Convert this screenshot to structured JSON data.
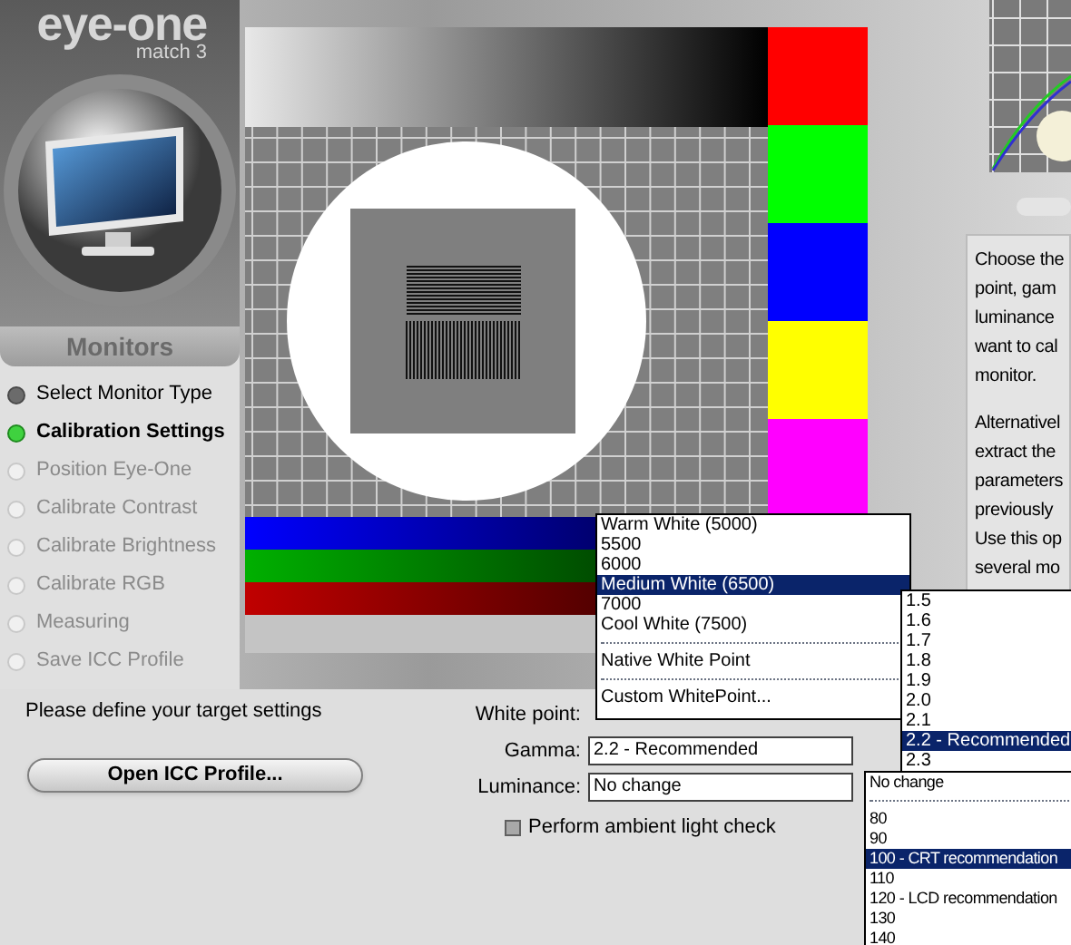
{
  "logo": {
    "name": "eye-one",
    "edition": "match 3"
  },
  "sidebar": {
    "title": "Monitors",
    "steps": [
      {
        "label": "Select Monitor Type",
        "done": true,
        "selected": false
      },
      {
        "label": "Calibration Settings",
        "done": false,
        "selected": true
      },
      {
        "label": "Position Eye-One",
        "done": false,
        "selected": false
      },
      {
        "label": "Calibrate Contrast",
        "done": false,
        "selected": false
      },
      {
        "label": "Calibrate Brightness",
        "done": false,
        "selected": false
      },
      {
        "label": "Calibrate RGB",
        "done": false,
        "selected": false
      },
      {
        "label": "Measuring",
        "done": false,
        "selected": false
      },
      {
        "label": "Save ICC Profile",
        "done": false,
        "selected": false
      }
    ]
  },
  "test_image": {
    "swatches": [
      {
        "color": "#ff0000"
      },
      {
        "color": "#00ff00"
      },
      {
        "color": "#0000ff"
      },
      {
        "color": "#ffff00"
      },
      {
        "color": "#ff00ff"
      }
    ],
    "ramps": [
      {
        "color": "#0000ff"
      },
      {
        "color": "#00b000"
      },
      {
        "color": "#c00000"
      }
    ]
  },
  "info_text": {
    "paragraphs": [
      [
        "Choose the",
        "point, gam",
        "luminance",
        "want to cal",
        "monitor."
      ],
      [
        "Alternativel",
        "extract the",
        "parameters",
        "previously",
        "Use this op",
        "several mo"
      ]
    ]
  },
  "prompt": "Please define your target settings",
  "open_button": "Open ICC Profile...",
  "settings": [
    {
      "label": "White point:"
    },
    {
      "label": "Gamma:",
      "value": "2.2 - Recommended"
    },
    {
      "label": "Luminance:",
      "value": "No change"
    }
  ],
  "ambient_check": {
    "label": "Perform ambient light check",
    "checked": false
  },
  "white_point_list": [
    {
      "kind": "option",
      "label": "Warm White (5000)",
      "selected": false
    },
    {
      "kind": "option",
      "label": "5500",
      "selected": false
    },
    {
      "kind": "option",
      "label": "6000",
      "selected": false
    },
    {
      "kind": "option",
      "label": "Medium White (6500)",
      "selected": true
    },
    {
      "kind": "option",
      "label": "7000",
      "selected": false
    },
    {
      "kind": "option",
      "label": "Cool White (7500)",
      "selected": false
    },
    {
      "kind": "divider"
    },
    {
      "kind": "option",
      "label": "Native White Point",
      "selected": false
    },
    {
      "kind": "divider"
    },
    {
      "kind": "option",
      "label": "Custom WhitePoint...",
      "selected": false
    }
  ],
  "gamma_list": [
    {
      "kind": "option",
      "label": "1.5",
      "selected": false
    },
    {
      "kind": "option",
      "label": "1.6",
      "selected": false
    },
    {
      "kind": "option",
      "label": "1.7",
      "selected": false
    },
    {
      "kind": "option",
      "label": "1.8",
      "selected": false
    },
    {
      "kind": "option",
      "label": "1.9",
      "selected": false
    },
    {
      "kind": "option",
      "label": "2.0",
      "selected": false
    },
    {
      "kind": "option",
      "label": "2.1",
      "selected": false
    },
    {
      "kind": "option",
      "label": "2.2 - Recommended",
      "selected": true
    },
    {
      "kind": "option",
      "label": "2.3",
      "selected": false
    }
  ],
  "luminance_list": [
    {
      "kind": "option",
      "label": "No change",
      "selected": false
    },
    {
      "kind": "divider"
    },
    {
      "kind": "option",
      "label": "80",
      "selected": false
    },
    {
      "kind": "option",
      "label": "90",
      "selected": false
    },
    {
      "kind": "option",
      "label": "100 - CRT recommendation",
      "selected": true
    },
    {
      "kind": "option",
      "label": "110",
      "selected": false
    },
    {
      "kind": "option",
      "label": "120 - LCD recommendation",
      "selected": false
    },
    {
      "kind": "option",
      "label": "130",
      "selected": false
    },
    {
      "kind": "option",
      "label": "140",
      "selected": false
    }
  ]
}
